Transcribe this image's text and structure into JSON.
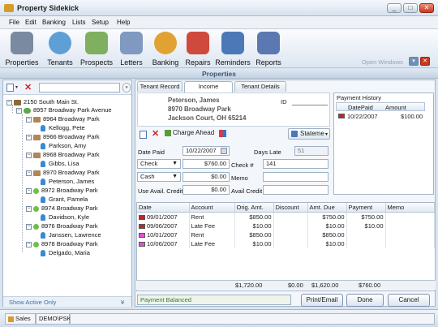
{
  "window": {
    "title": "Property Sidekick",
    "min": "_",
    "max": "□",
    "close": "✕"
  },
  "menu": [
    "File",
    "Edit",
    "Banking",
    "Lists",
    "Setup",
    "Help"
  ],
  "toolbar": [
    {
      "label": "Properties",
      "icon": "properties-icon",
      "color": "#7a8aa0"
    },
    {
      "label": "Tenants",
      "icon": "tenants-icon",
      "color": "#5ea0d6"
    },
    {
      "label": "Prospects",
      "icon": "prospects-icon",
      "color": "#7fb060"
    },
    {
      "label": "Letters",
      "icon": "letters-icon",
      "color": "#7f99c0"
    },
    {
      "label": "Banking",
      "icon": "banking-icon",
      "color": "#e2a233"
    },
    {
      "label": "Repairs",
      "icon": "repairs-icon",
      "color": "#cf4a3d"
    },
    {
      "label": "Reminders",
      "icon": "reminders-icon",
      "color": "#4d78b8"
    },
    {
      "label": "Reports",
      "icon": "reports-icon",
      "color": "#5b79b0"
    }
  ],
  "open_windows_label": "Open Windows",
  "section_header": "Properties",
  "tree": {
    "root": "2150 South Main St.",
    "property": "8957 Broadway Park Avenue",
    "units": [
      {
        "unit": "8964 Broadway Park",
        "tenant": "Kellogg, Pete"
      },
      {
        "unit": "8966 Broadway Park",
        "tenant": "Parkson, Amy"
      },
      {
        "unit": "8968 Broadway Park",
        "tenant": "Gibbs, Lisa"
      },
      {
        "unit": "8970 Broadway Park",
        "tenant": "Peterson, James"
      },
      {
        "unit": "8972 Broadway Park",
        "tenant": "Grant, Pamela"
      },
      {
        "unit": "8974 Broadway Park",
        "tenant": "Davidson, Kyle"
      },
      {
        "unit": "8976 Broadway Park",
        "tenant": "Janssen, Lawrence"
      },
      {
        "unit": "8978 Broadway Park",
        "tenant": "Delgado, Maria"
      }
    ],
    "show_active_only": "Show Active Only"
  },
  "tabs": [
    "Tenant Record",
    "Income",
    "Tenant Details"
  ],
  "tenant": {
    "name": "Peterson, James",
    "address1": "8970 Broadway Park",
    "address2": "Jackson Court, OH 65214",
    "id_label": "ID"
  },
  "payment_history": {
    "title": "Payment History",
    "headers": [
      "DatePaid",
      "Amount"
    ],
    "rows": [
      {
        "date": "10/22/2007",
        "amount": "$100.00"
      }
    ]
  },
  "actions": {
    "charge_ahead": "Charge Ahead",
    "statement": "Stateme"
  },
  "form": {
    "date_paid_label": "Date Paid",
    "date_paid": "10/22/2007",
    "days_late_label": "Days Late",
    "days_late": "51",
    "check_type": "Check",
    "check_amount": "$760.00",
    "check_no_label": "Check #",
    "check_no": "141",
    "cash_type": "Cash",
    "cash_amount": "$0.00",
    "memo_label": "Memo",
    "memo": "",
    "use_avail_label": "Use Avail. Credit",
    "use_avail": "$0.00",
    "avail_credit_label": "Avail Credit",
    "avail_credit": ""
  },
  "charges": {
    "headers": [
      "Date",
      "Account",
      "Orig. Amt.",
      "Discount",
      "Amt. Due",
      "Payment",
      "Memo"
    ],
    "rows": [
      {
        "flag": "#c0262a",
        "date": "09/01/2007",
        "account": "Rent",
        "orig": "$850.00",
        "discount": "",
        "due": "$750.00",
        "payment": "$750.00"
      },
      {
        "flag": "#c0262a",
        "date": "09/06/2007",
        "account": "Late Fee",
        "orig": "$10.00",
        "discount": "",
        "due": "$10.00",
        "payment": "$10.00"
      },
      {
        "flag": "#e44fd8",
        "date": "10/01/2007",
        "account": "Rent",
        "orig": "$850.00",
        "discount": "",
        "due": "$850.00",
        "payment": ""
      },
      {
        "flag": "#e44fd8",
        "date": "10/06/2007",
        "account": "Late Fee",
        "orig": "$10.00",
        "discount": "",
        "due": "$10.00",
        "payment": ""
      }
    ],
    "totals": {
      "orig": "$1,720.00",
      "discount": "$0.00",
      "due": "$1,620.00",
      "payment": "$760.00"
    }
  },
  "balanced_text": "Payment Balanced",
  "buttons": {
    "print": "Print/Email",
    "done": "Done",
    "cancel": "Cancel"
  },
  "status": {
    "sales": "Sales",
    "company": "DEMO\\PSK"
  }
}
